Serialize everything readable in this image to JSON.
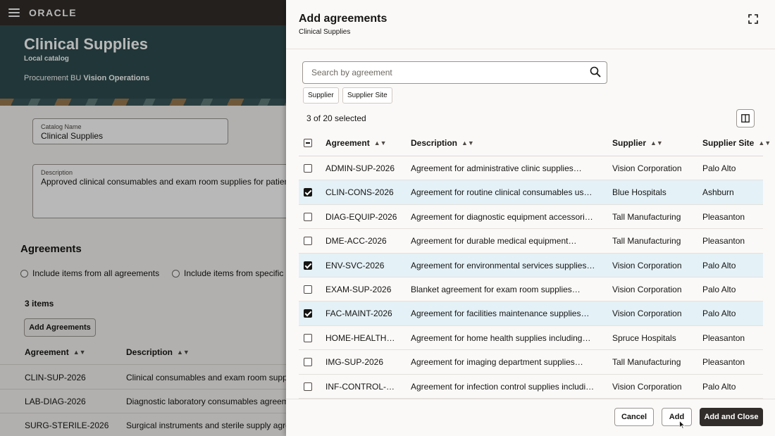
{
  "app": {
    "logo": "ORACLE"
  },
  "hero": {
    "title": "Clinical Supplies",
    "subtitle": "Local catalog",
    "bu_label": "Procurement BU",
    "bu_value": "Vision Operations"
  },
  "form": {
    "catalog_name_label": "Catalog Name",
    "catalog_name_value": "Clinical Supplies",
    "description_label": "Description",
    "description_value": "Approved clinical consumables and exam room supplies for patient"
  },
  "agreements_section": {
    "title": "Agreements",
    "radio_all": "Include items from all agreements",
    "radio_specific": "Include items from specific a",
    "items_count": "3 items",
    "add_button": "Add Agreements",
    "columns": [
      "Agreement",
      "Description"
    ],
    "rows": [
      {
        "agreement": "CLIN-SUP-2026",
        "description": "Clinical consumables and exam room supply"
      },
      {
        "agreement": "LAB-DIAG-2026",
        "description": "Diagnostic laboratory consumables agreeme"
      },
      {
        "agreement": "SURG-STERILE-2026",
        "description": "Surgical instruments and sterile supply agre"
      }
    ]
  },
  "drawer": {
    "title": "Add agreements",
    "subtitle": "Clinical Supplies",
    "search_placeholder": "Search by agreement",
    "filter_chips": [
      "Supplier",
      "Supplier Site"
    ],
    "selected_count": "3 of 20 selected",
    "columns": [
      "Agreement",
      "Description",
      "Supplier",
      "Supplier Site"
    ],
    "rows": [
      {
        "checked": false,
        "agreement": "ADMIN-SUP-2026",
        "description": "Agreement for administrative clinic supplies…",
        "supplier": "Vision Corporation",
        "site": "Palo Alto"
      },
      {
        "checked": true,
        "agreement": "CLIN-CONS-2026",
        "description": "Agreement for routine clinical consumables use…",
        "supplier": "Blue Hospitals",
        "site": "Ashburn"
      },
      {
        "checked": false,
        "agreement": "DIAG-EQUIP-2026",
        "description": "Agreement for diagnostic equipment accessorie…",
        "supplier": "Tall Manufacturing",
        "site": "Pleasanton"
      },
      {
        "checked": false,
        "agreement": "DME-ACC-2026",
        "description": "Agreement for durable medical equipment…",
        "supplier": "Tall Manufacturing",
        "site": "Pleasanton"
      },
      {
        "checked": true,
        "agreement": "ENV-SVC-2026",
        "description": "Agreement for environmental services supplies…",
        "supplier": "Vision Corporation",
        "site": "Palo Alto"
      },
      {
        "checked": false,
        "agreement": "EXAM-SUP-2026",
        "description": "Blanket agreement for exam room supplies…",
        "supplier": "Vision Corporation",
        "site": "Palo Alto"
      },
      {
        "checked": true,
        "agreement": "FAC-MAINT-2026",
        "description": "Agreement for facilities maintenance supplies…",
        "supplier": "Vision Corporation",
        "site": "Palo Alto"
      },
      {
        "checked": false,
        "agreement": "HOME-HEALTH…",
        "description": "Agreement for home health supplies including…",
        "supplier": "Spruce Hospitals",
        "site": "Pleasanton"
      },
      {
        "checked": false,
        "agreement": "IMG-SUP-2026",
        "description": "Agreement for imaging department supplies…",
        "supplier": "Tall Manufacturing",
        "site": "Pleasanton"
      },
      {
        "checked": false,
        "agreement": "INF-CONTROL-…",
        "description": "Agreement for infection control supplies includi…",
        "supplier": "Vision Corporation",
        "site": "Palo Alto"
      }
    ],
    "buttons": {
      "cancel": "Cancel",
      "add": "Add",
      "add_close": "Add and Close"
    }
  }
}
